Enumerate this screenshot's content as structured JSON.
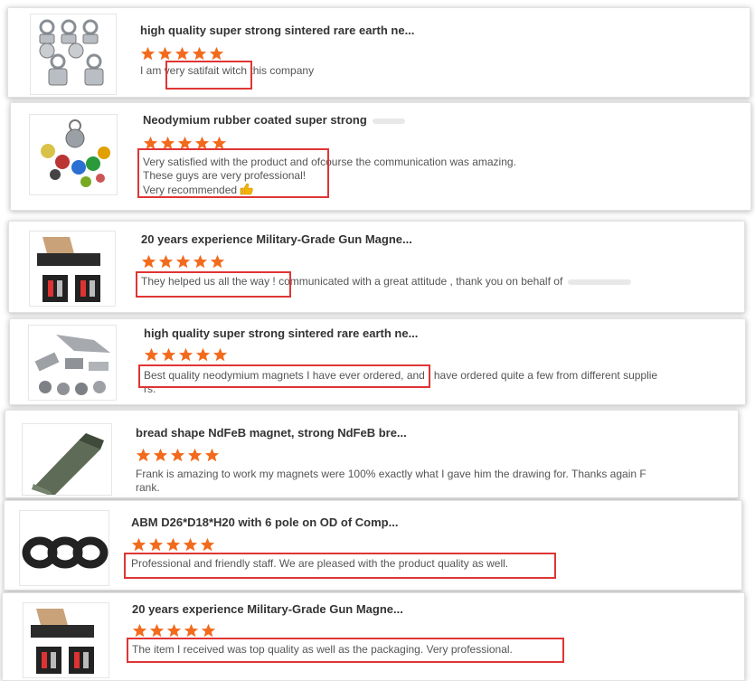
{
  "colors": {
    "star": "#f26b1d",
    "highlight": "#e03535",
    "title": "#333333",
    "text": "#555555"
  },
  "reviews": [
    {
      "title": "high quality super strong sintered rare earth ne...",
      "rating": 5,
      "lines": [
        "I am very satifait witch this company"
      ],
      "thumb_icon": "ring-magnet-hooks-icon"
    },
    {
      "title": "Neodymium rubber coated super strong",
      "rating": 5,
      "lines": [
        "Very satisfied with the product and ofcourse the communication was amazing.",
        "These guys are very professional!",
        "Very recommended"
      ],
      "emoji_icon": "thumbs-up-icon",
      "thumb_icon": "colored-pot-magnets-icon"
    },
    {
      "title": "20 years experience Military-Grade Gun Magne...",
      "rating": 5,
      "lines": [
        "They helped us all the way ! communicated with a great attitude , thank you on behalf of"
      ],
      "thumb_icon": "gun-magnet-kit-icon"
    },
    {
      "title": "high quality super strong sintered rare earth ne...",
      "rating": 5,
      "lines": [
        "Best quality neodymium magnets I have ever ordered, and I have ordered quite a few from different supplie",
        "rs."
      ],
      "thumb_icon": "assorted-magnets-icon"
    },
    {
      "title": "bread shape NdFeB magnet, strong NdFeB bre...",
      "rating": 5,
      "lines": [
        "Frank is amazing to work my magnets were 100% exactly what I gave him the drawing for.  Thanks again F",
        "rank."
      ],
      "thumb_icon": "bread-shape-magnet-icon"
    },
    {
      "title": "ABM D26*D18*H20 with 6 pole on OD of Comp...",
      "rating": 5,
      "lines": [
        "Professional and friendly staff. We are pleased with the product quality as well."
      ],
      "thumb_icon": "black-ring-magnets-icon"
    },
    {
      "title": "20 years experience Military-Grade Gun Magne...",
      "rating": 5,
      "lines": [
        "The item I received was top quality as well as the packaging. Very professional."
      ],
      "thumb_icon": "gun-magnet-kit-icon"
    }
  ]
}
